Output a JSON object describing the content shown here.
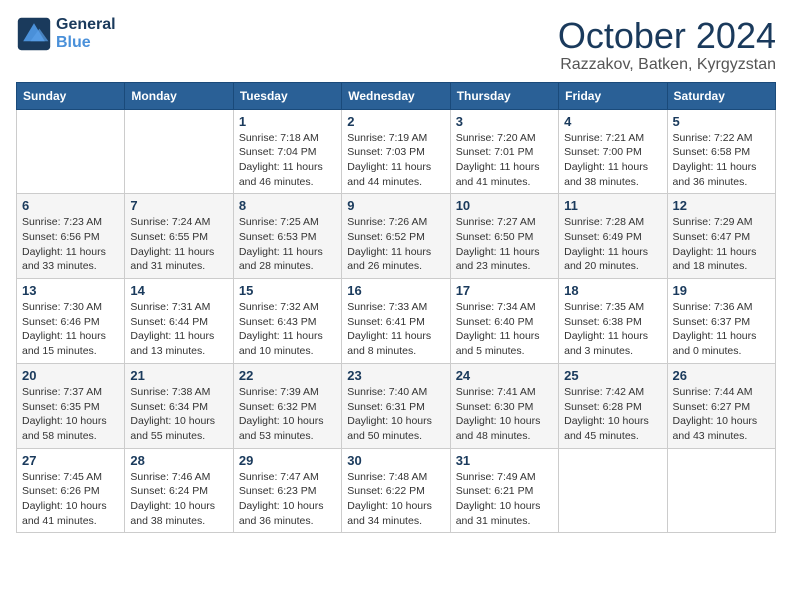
{
  "header": {
    "logo_line1": "General",
    "logo_line2": "Blue",
    "month_title": "October 2024",
    "location": "Razzakov, Batken, Kyrgyzstan"
  },
  "days_of_week": [
    "Sunday",
    "Monday",
    "Tuesday",
    "Wednesday",
    "Thursday",
    "Friday",
    "Saturday"
  ],
  "weeks": [
    [
      {
        "day": "",
        "info": ""
      },
      {
        "day": "",
        "info": ""
      },
      {
        "day": "1",
        "info": "Sunrise: 7:18 AM\nSunset: 7:04 PM\nDaylight: 11 hours and 46 minutes."
      },
      {
        "day": "2",
        "info": "Sunrise: 7:19 AM\nSunset: 7:03 PM\nDaylight: 11 hours and 44 minutes."
      },
      {
        "day": "3",
        "info": "Sunrise: 7:20 AM\nSunset: 7:01 PM\nDaylight: 11 hours and 41 minutes."
      },
      {
        "day": "4",
        "info": "Sunrise: 7:21 AM\nSunset: 7:00 PM\nDaylight: 11 hours and 38 minutes."
      },
      {
        "day": "5",
        "info": "Sunrise: 7:22 AM\nSunset: 6:58 PM\nDaylight: 11 hours and 36 minutes."
      }
    ],
    [
      {
        "day": "6",
        "info": "Sunrise: 7:23 AM\nSunset: 6:56 PM\nDaylight: 11 hours and 33 minutes."
      },
      {
        "day": "7",
        "info": "Sunrise: 7:24 AM\nSunset: 6:55 PM\nDaylight: 11 hours and 31 minutes."
      },
      {
        "day": "8",
        "info": "Sunrise: 7:25 AM\nSunset: 6:53 PM\nDaylight: 11 hours and 28 minutes."
      },
      {
        "day": "9",
        "info": "Sunrise: 7:26 AM\nSunset: 6:52 PM\nDaylight: 11 hours and 26 minutes."
      },
      {
        "day": "10",
        "info": "Sunrise: 7:27 AM\nSunset: 6:50 PM\nDaylight: 11 hours and 23 minutes."
      },
      {
        "day": "11",
        "info": "Sunrise: 7:28 AM\nSunset: 6:49 PM\nDaylight: 11 hours and 20 minutes."
      },
      {
        "day": "12",
        "info": "Sunrise: 7:29 AM\nSunset: 6:47 PM\nDaylight: 11 hours and 18 minutes."
      }
    ],
    [
      {
        "day": "13",
        "info": "Sunrise: 7:30 AM\nSunset: 6:46 PM\nDaylight: 11 hours and 15 minutes."
      },
      {
        "day": "14",
        "info": "Sunrise: 7:31 AM\nSunset: 6:44 PM\nDaylight: 11 hours and 13 minutes."
      },
      {
        "day": "15",
        "info": "Sunrise: 7:32 AM\nSunset: 6:43 PM\nDaylight: 11 hours and 10 minutes."
      },
      {
        "day": "16",
        "info": "Sunrise: 7:33 AM\nSunset: 6:41 PM\nDaylight: 11 hours and 8 minutes."
      },
      {
        "day": "17",
        "info": "Sunrise: 7:34 AM\nSunset: 6:40 PM\nDaylight: 11 hours and 5 minutes."
      },
      {
        "day": "18",
        "info": "Sunrise: 7:35 AM\nSunset: 6:38 PM\nDaylight: 11 hours and 3 minutes."
      },
      {
        "day": "19",
        "info": "Sunrise: 7:36 AM\nSunset: 6:37 PM\nDaylight: 11 hours and 0 minutes."
      }
    ],
    [
      {
        "day": "20",
        "info": "Sunrise: 7:37 AM\nSunset: 6:35 PM\nDaylight: 10 hours and 58 minutes."
      },
      {
        "day": "21",
        "info": "Sunrise: 7:38 AM\nSunset: 6:34 PM\nDaylight: 10 hours and 55 minutes."
      },
      {
        "day": "22",
        "info": "Sunrise: 7:39 AM\nSunset: 6:32 PM\nDaylight: 10 hours and 53 minutes."
      },
      {
        "day": "23",
        "info": "Sunrise: 7:40 AM\nSunset: 6:31 PM\nDaylight: 10 hours and 50 minutes."
      },
      {
        "day": "24",
        "info": "Sunrise: 7:41 AM\nSunset: 6:30 PM\nDaylight: 10 hours and 48 minutes."
      },
      {
        "day": "25",
        "info": "Sunrise: 7:42 AM\nSunset: 6:28 PM\nDaylight: 10 hours and 45 minutes."
      },
      {
        "day": "26",
        "info": "Sunrise: 7:44 AM\nSunset: 6:27 PM\nDaylight: 10 hours and 43 minutes."
      }
    ],
    [
      {
        "day": "27",
        "info": "Sunrise: 7:45 AM\nSunset: 6:26 PM\nDaylight: 10 hours and 41 minutes."
      },
      {
        "day": "28",
        "info": "Sunrise: 7:46 AM\nSunset: 6:24 PM\nDaylight: 10 hours and 38 minutes."
      },
      {
        "day": "29",
        "info": "Sunrise: 7:47 AM\nSunset: 6:23 PM\nDaylight: 10 hours and 36 minutes."
      },
      {
        "day": "30",
        "info": "Sunrise: 7:48 AM\nSunset: 6:22 PM\nDaylight: 10 hours and 34 minutes."
      },
      {
        "day": "31",
        "info": "Sunrise: 7:49 AM\nSunset: 6:21 PM\nDaylight: 10 hours and 31 minutes."
      },
      {
        "day": "",
        "info": ""
      },
      {
        "day": "",
        "info": ""
      }
    ]
  ]
}
